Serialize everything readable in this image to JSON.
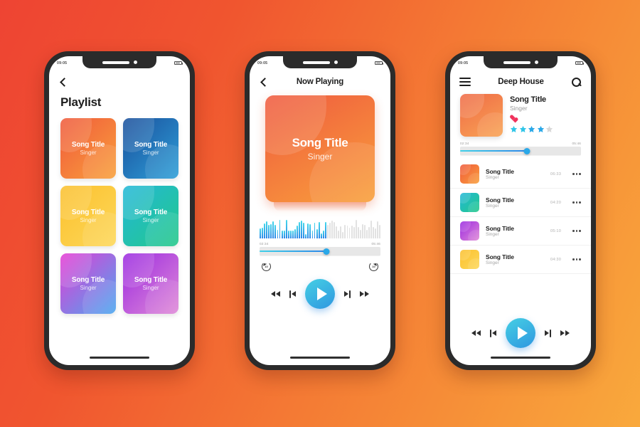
{
  "background": {
    "from": "#ee4433",
    "to": "#f9a93c"
  },
  "status_bar": {
    "time": "09:05",
    "battery_icon": "battery-icon"
  },
  "phone1": {
    "back_icon": "chevron-left-icon",
    "title": "Playlist",
    "cards": [
      {
        "title": "Song Title",
        "singer": "Singer",
        "from": "#f0593b",
        "to": "#f9a03c"
      },
      {
        "title": "Song Title",
        "singer": "Singer",
        "from": "#1a4f9c",
        "to": "#2e9fd8"
      },
      {
        "title": "Song Title",
        "singer": "Singer",
        "from": "#fbc02d",
        "to": "#fdd85a"
      },
      {
        "title": "Song Title",
        "singer": "Singer",
        "from": "#22b7d8",
        "to": "#24c98a"
      },
      {
        "title": "Song Title",
        "singer": "Singer",
        "from": "#e63ad4",
        "to": "#4aa8f0"
      },
      {
        "title": "Song Title",
        "singer": "Singer",
        "from": "#9b2ae0",
        "to": "#e08ad8"
      }
    ]
  },
  "phone2": {
    "back_icon": "chevron-left-icon",
    "title": "Now Playing",
    "art": {
      "title": "Song Title",
      "singer": "Singer",
      "from": "#ef5a3e",
      "to": "#f9a03c"
    },
    "waveform_icon": "audio-waveform",
    "progress": {
      "elapsed": "02:34",
      "remaining": "05:46",
      "percent": 55,
      "fill_from": "#3fd0e8",
      "fill_to": "#2d86e8"
    },
    "replay_back_label": "10",
    "replay_fwd_label": "10",
    "controls": {
      "rewind_icon": "rewind-icon",
      "previous_icon": "skip-previous-icon",
      "play_icon": "play-icon",
      "next_icon": "skip-next-icon",
      "fast_forward_icon": "fast-forward-icon"
    }
  },
  "phone3": {
    "menu_icon": "hamburger-menu-icon",
    "title": "Deep House",
    "search_icon": "search-icon",
    "now_playing": {
      "title": "Song Title",
      "singer": "Singer",
      "art_from": "#ef6a46",
      "art_to": "#f9a455",
      "favorite_icon": "heart-icon",
      "rating": 4,
      "rating_max": 5,
      "star_color": "#2aa8e8",
      "star_empty_color": "#d8d8d8"
    },
    "progress": {
      "elapsed": "02:34",
      "remaining": "05:46",
      "percent": 55
    },
    "tracks": [
      {
        "title": "Song Title",
        "singer": "Singer",
        "duration": "06:33",
        "from": "#f0593b",
        "to": "#f9a03c",
        "menu_icon": "more-options-icon"
      },
      {
        "title": "Song Title",
        "singer": "Singer",
        "duration": "04:20",
        "from": "#22b7d8",
        "to": "#24c98a",
        "menu_icon": "more-options-icon"
      },
      {
        "title": "Song Title",
        "singer": "Singer",
        "duration": "05:10",
        "from": "#9b2ae0",
        "to": "#e08ad8",
        "menu_icon": "more-options-icon"
      },
      {
        "title": "Song Title",
        "singer": "Singer",
        "duration": "04:30",
        "from": "#fbc02d",
        "to": "#fdd85a",
        "menu_icon": "more-options-icon"
      }
    ],
    "controls": {
      "rewind_icon": "rewind-icon",
      "previous_icon": "skip-previous-icon",
      "play_icon": "play-icon",
      "next_icon": "skip-next-icon",
      "fast_forward_icon": "fast-forward-icon"
    }
  }
}
